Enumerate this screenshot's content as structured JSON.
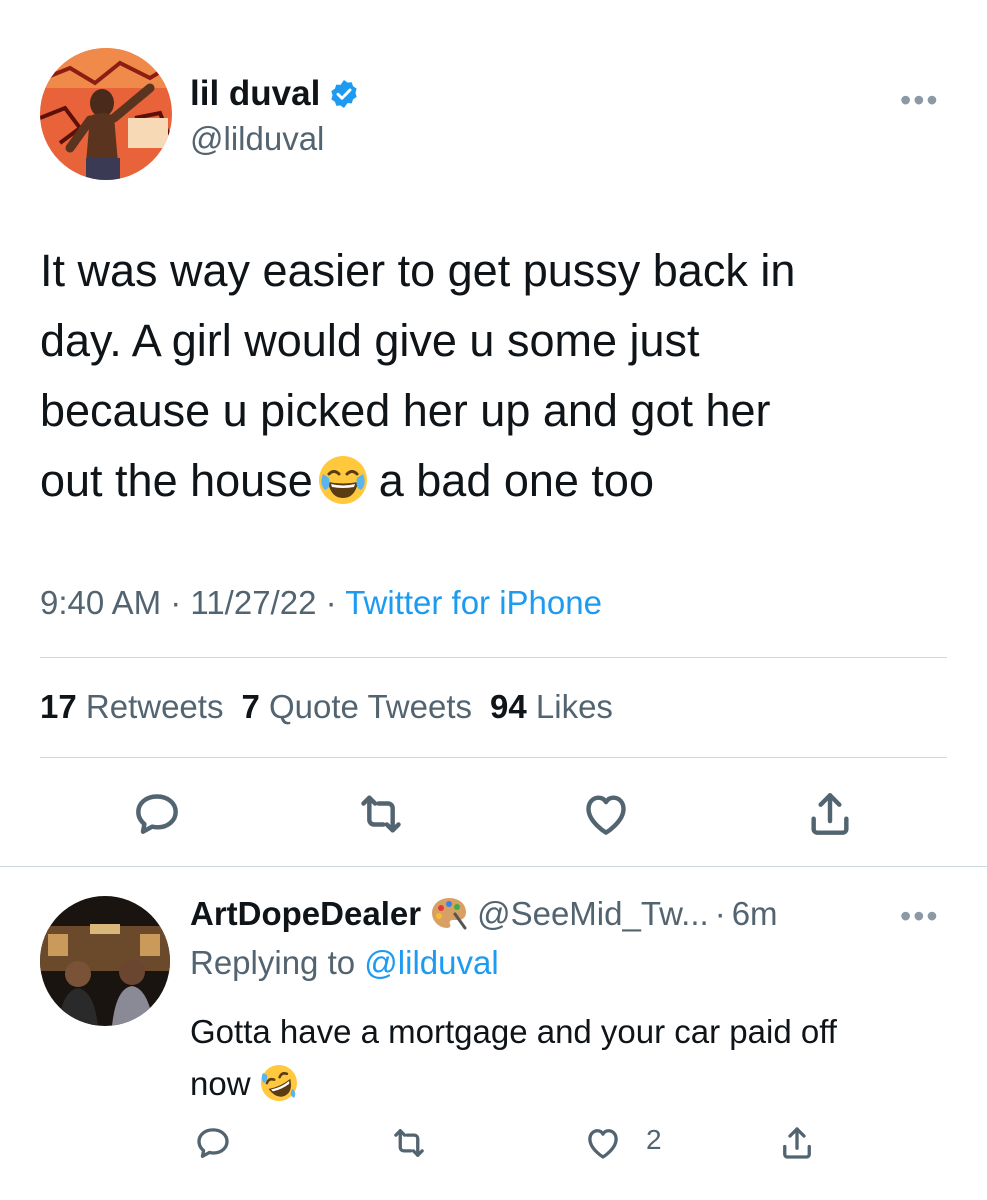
{
  "tweet": {
    "display_name": "lil duval",
    "handle": "@lilduval",
    "avatar_icon": "profile-photo",
    "verified_icon": "verified-badge-icon",
    "more_icon": "more-options-icon",
    "text_line1": "It was way easier to get pussy back in",
    "text_line2": "day. A girl would give u some just",
    "text_line3": "because u picked her up and got her",
    "text_line4_before": "out the house",
    "text_emoji": "face-with-tears-of-joy",
    "text_line4_after": "a bad one too",
    "time": "9:40 AM",
    "date": "11/27/22",
    "source": "Twitter for iPhone",
    "meta_sep": "·",
    "stats": {
      "retweets_count": "17",
      "retweets_label": "Retweets",
      "quotes_count": "7",
      "quotes_label": "Quote Tweets",
      "likes_count": "94",
      "likes_label": "Likes"
    },
    "actions": [
      "reply-icon",
      "retweet-icon",
      "like-icon",
      "share-icon"
    ]
  },
  "reply": {
    "display_name": "ArtDopeDealer",
    "name_emoji": "artist-palette",
    "handle": "@SeeMid_Tw...",
    "time_sep": "·",
    "time": "6m",
    "replying_prefix": "Replying to",
    "replying_to": "@lilduval",
    "text_line1": "Gotta have a mortgage and your car paid off",
    "text_line2": "now",
    "text_emoji": "rolling-on-the-floor-laughing",
    "like_count": "2"
  },
  "colors": {
    "text": "#0f1419",
    "secondary": "#536471",
    "accent": "#1d9bf0",
    "divider": "#cfd9de"
  }
}
